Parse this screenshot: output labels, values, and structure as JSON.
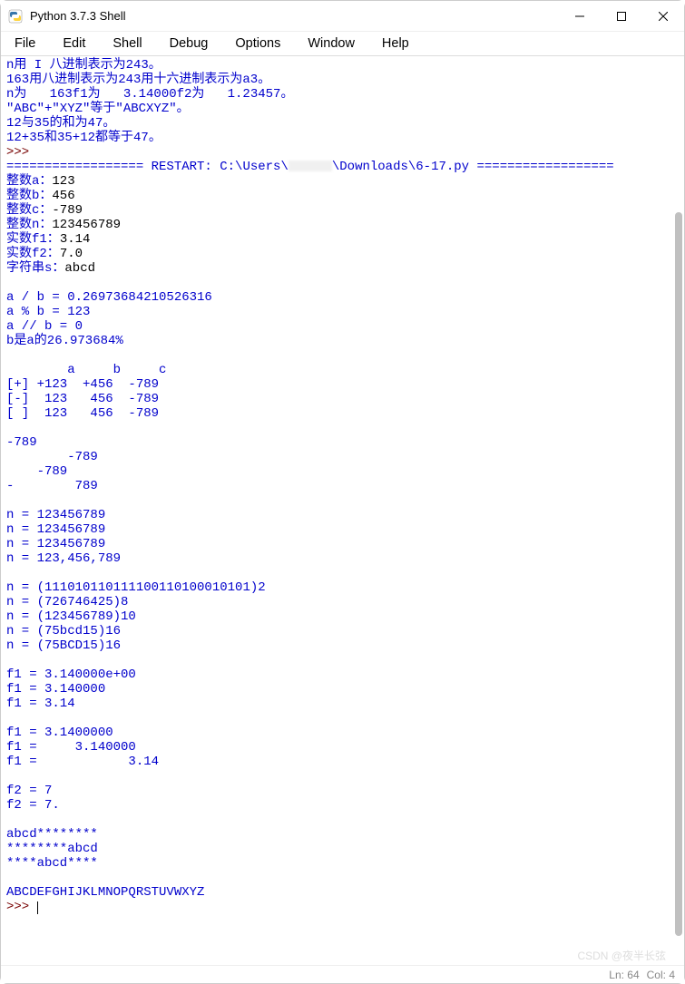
{
  "window": {
    "title": "Python 3.7.3 Shell"
  },
  "menu": {
    "file": "File",
    "edit": "Edit",
    "shell": "Shell",
    "debug": "Debug",
    "options": "Options",
    "window": "Window",
    "help": "Help"
  },
  "output": {
    "l0": "n用 I 八进制表示为243。",
    "l1": "163用八进制表示为243用十六进制表示为a3。",
    "l2": "n为   163f1为   3.14000f2为   1.23457。",
    "l3": "\"ABC\"+\"XYZ\"等于\"ABCXYZ\"。",
    "l4": "12与35的和为47。",
    "l5": "12+35和35+12都等于47。",
    "prompt1": ">>> ",
    "restart_pre": "================== RESTART: C:\\Users\\",
    "restart_post": "\\Downloads\\6-17.py ==================",
    "l7": "整数a：",
    "l7i": "123",
    "l8": "整数b：",
    "l8i": "456",
    "l9": "整数c：",
    "l9i": "-789",
    "l10": "整数n：",
    "l10i": "123456789",
    "l11": "实数f1：",
    "l11i": "3.14",
    "l12": "实数f2：",
    "l12i": "7.0",
    "l13": "字符串s：",
    "l13i": "abcd",
    "l14": "",
    "l15": "a / b = 0.26973684210526316",
    "l16": "a % b = 123",
    "l17": "a // b = 0",
    "l18": "b是a的26.973684%",
    "l19": "",
    "l20": "        a     b     c",
    "l21": "[+] +123  +456  -789",
    "l22": "[-]  123   456  -789",
    "l23": "[ ]  123   456  -789",
    "l24": "",
    "l25": "-789",
    "l26": "        -789",
    "l27": "    -789    ",
    "l28": "-        789",
    "l29": "",
    "l30": "n = 123456789",
    "l31": "n = 123456789",
    "l32": "n = 123456789",
    "l33": "n = 123,456,789",
    "l34": "",
    "l35": "n = (111010110111100110100010101)2",
    "l36": "n = (726746425)8",
    "l37": "n = (123456789)10",
    "l38": "n = (75bcd15)16",
    "l39": "n = (75BCD15)16",
    "l40": "",
    "l41": "f1 = 3.140000e+00",
    "l42": "f1 = 3.140000",
    "l43": "f1 = 3.14",
    "l44": "",
    "l45": "f1 = 3.1400000",
    "l46": "f1 =     3.140000",
    "l47": "f1 =            3.14",
    "l48": "",
    "l49": "f2 = 7",
    "l50": "f2 = 7.",
    "l51": "",
    "l52": "abcd********",
    "l53": "********abcd",
    "l54": "****abcd****",
    "l55": "",
    "l56": "ABCDEFGHIJKLMNOPQRSTUVWXYZ",
    "prompt2": ">>> "
  },
  "status": {
    "ln": "Ln: 64",
    "col": "Col: 4"
  },
  "watermark": "CSDN @夜半长弦"
}
